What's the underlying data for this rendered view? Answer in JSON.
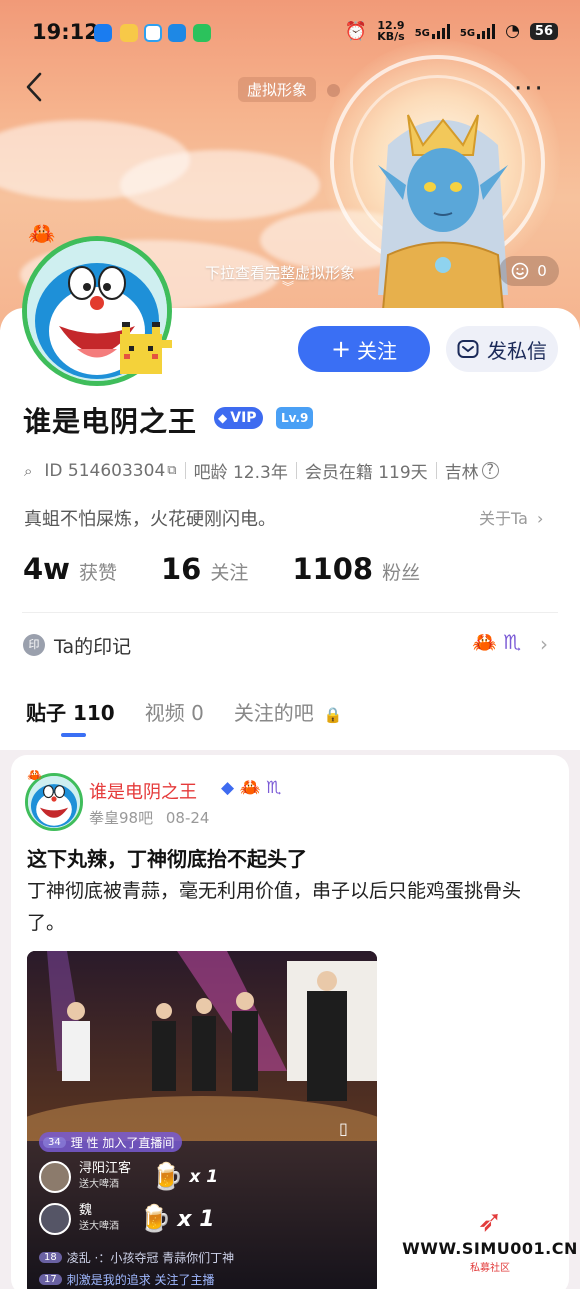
{
  "status_bar": {
    "time": "19:12",
    "net_speed": "12.9",
    "net_unit": "KB/s",
    "sig1": "5G",
    "sig2": "5G",
    "battery": "56"
  },
  "header": {
    "virtual_tag": "虚拟形象",
    "pull_hint": "下拉查看完整虚拟形象",
    "like_count": "0"
  },
  "profile": {
    "username": "谁是电阴之王",
    "vip_label": "VIP",
    "level": "Lv.9",
    "id_text": "ID 514603304",
    "bar_age": "吧龄 12.3年",
    "member_days": "会员在籍 119天",
    "location": "吉林",
    "bio": "真蛆不怕屎炼，火花硬刚闪电。",
    "about_label": "关于Ta",
    "follow_label": "关注",
    "message_label": "发私信",
    "stats": [
      {
        "num": "4w",
        "label": "获赞"
      },
      {
        "num": "16",
        "label": "关注"
      },
      {
        "num": "1108",
        "label": "粉丝"
      }
    ],
    "mark_icon_text": "印",
    "mark_label": "Ta的印记"
  },
  "tabs": [
    {
      "label": "贴子 110",
      "active": true
    },
    {
      "label": "视频 0",
      "active": false
    },
    {
      "label": "关注的吧",
      "active": false
    }
  ],
  "post": {
    "author": "谁是电阴之王",
    "forum": "拳皇98吧",
    "date": "08-24",
    "title": "这下丸辣，丁神彻底抬不起头了",
    "body": "丁神彻底被青蒜，毫无利用价值，串子以后只能鸡蛋挑骨头了。",
    "video": {
      "join_level": "34",
      "join_text": "理 性 加入了直播间",
      "gifts": [
        {
          "user": "浔阳江客",
          "desc": "送大啤酒",
          "count": "x 1"
        },
        {
          "user": "魏",
          "desc": "送大啤酒",
          "count": "x 1"
        }
      ],
      "chat": [
        {
          "level": "18",
          "text": "凌乱  ·：小孩夺冠 青蒜你们丁神"
        },
        {
          "level": "17",
          "text": "刺激是我的追求 关注了主播"
        }
      ]
    }
  },
  "watermark": {
    "url": "WWW.SIMU001.CN",
    "sub": "私募社区"
  },
  "icons": {
    "back": "chevron-left-icon",
    "more": "more-dots-icon",
    "like": "smile-icon",
    "message": "mail-icon",
    "plus": "plus-icon",
    "lock": "lock-icon"
  },
  "colors": {
    "accent": "#3a6ff4",
    "avatar_ring": "#3fbd5b",
    "author_red": "#e53a3a"
  }
}
